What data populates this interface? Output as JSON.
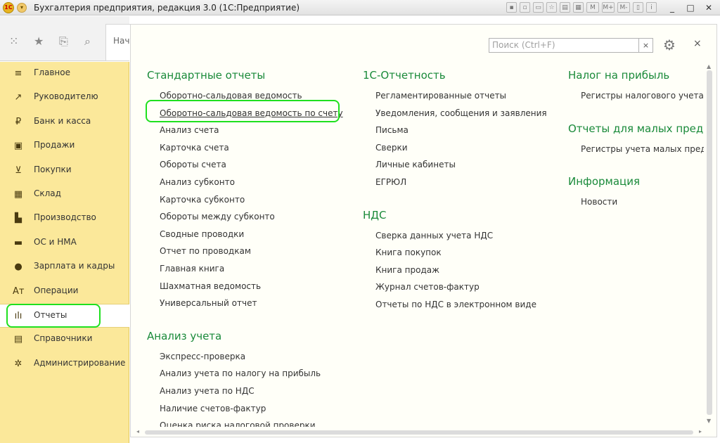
{
  "window": {
    "title": "Бухгалтерия предприятия, редакция 3.0  (1С:Предприятие)",
    "logo_text": "1С",
    "tool_labels": [
      "M",
      "M+",
      "M-"
    ],
    "controls": [
      "_",
      "□",
      "✕"
    ]
  },
  "topbar": {
    "start_tab": "Нач"
  },
  "sidebar": {
    "items": [
      {
        "label": "Главное",
        "icon": "≡"
      },
      {
        "label": "Руководителю",
        "icon": "↗"
      },
      {
        "label": "Банк и касса",
        "icon": "₽"
      },
      {
        "label": "Продажи",
        "icon": "▣"
      },
      {
        "label": "Покупки",
        "icon": "⊻"
      },
      {
        "label": "Склад",
        "icon": "▦"
      },
      {
        "label": "Производство",
        "icon": "▙"
      },
      {
        "label": "ОС и НМА",
        "icon": "▬"
      },
      {
        "label": "Зарплата и кадры",
        "icon": "●"
      },
      {
        "label": "Операции",
        "icon": "Ат"
      },
      {
        "label": "Отчеты",
        "icon": "ılı"
      },
      {
        "label": "Справочники",
        "icon": "▤"
      },
      {
        "label": "Администрирование",
        "icon": "✲"
      }
    ],
    "active_index": 10
  },
  "panel": {
    "search_placeholder": "Поиск (Ctrl+F)",
    "search_clear": "×",
    "close": "×",
    "columns": [
      {
        "sections": [
          {
            "title": "Стандартные отчеты",
            "links": [
              "Оборотно-сальдовая ведомость",
              "Оборотно-сальдовая ведомость по счету",
              "Анализ счета",
              "Карточка счета",
              "Обороты счета",
              "Анализ субконто",
              "Карточка субконто",
              "Обороты между субконто",
              "Сводные проводки",
              "Отчет по проводкам",
              "Главная книга",
              "Шахматная ведомость",
              "Универсальный отчет"
            ]
          },
          {
            "title": "Анализ учета",
            "links": [
              "Экспресс-проверка",
              "Анализ учета по налогу на прибыль",
              "Анализ учета по НДС",
              "Наличие счетов-фактур",
              "Оценка риска налоговой проверки"
            ]
          }
        ]
      },
      {
        "sections": [
          {
            "title": "1С-Отчетность",
            "links": [
              "Регламентированные отчеты",
              "Уведомления, сообщения и заявления",
              "Письма",
              "Сверки",
              "Личные кабинеты",
              "ЕГРЮЛ"
            ]
          },
          {
            "title": "НДС",
            "links": [
              "Сверка данных учета НДС",
              "Книга покупок",
              "Книга продаж",
              "Журнал счетов-фактур",
              "Отчеты по НДС в электронном виде"
            ]
          }
        ]
      },
      {
        "sections": [
          {
            "title": "Налог на прибыль",
            "links": [
              "Регистры налогового учета"
            ]
          },
          {
            "title": "Отчеты для малых предприятий",
            "links": [
              "Регистры учета малых предприятий"
            ]
          },
          {
            "title": "Информация",
            "links": [
              "Новости"
            ]
          }
        ]
      }
    ]
  },
  "colors": {
    "sidebar_bg": "#fbe89a",
    "section_title": "#1a8a3a",
    "highlight": "#1fe01f"
  }
}
